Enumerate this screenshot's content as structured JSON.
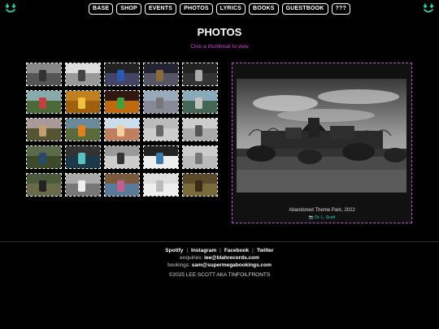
{
  "header": {
    "left_icon": "smiley-icon",
    "right_icon": "smiley-icon",
    "icon_color": "#2fd6b4"
  },
  "nav": [
    {
      "label": "BASE"
    },
    {
      "label": "SHOP"
    },
    {
      "label": "EVENTS"
    },
    {
      "label": "PHOTOS"
    },
    {
      "label": "LYRICS"
    },
    {
      "label": "BOOKS"
    },
    {
      "label": "GUESTBOOK"
    },
    {
      "label": "???"
    }
  ],
  "page": {
    "title": "PHOTOS",
    "subtitle": "Click a thumbnail to view",
    "accent": "#e040e0"
  },
  "thumbnails": [
    {
      "tone": [
        "#888",
        "#555",
        "#333"
      ]
    },
    {
      "tone": [
        "#ddd",
        "#999",
        "#444"
      ]
    },
    {
      "tone": [
        "#222",
        "#446",
        "#2a5ab0"
      ]
    },
    {
      "tone": [
        "#223",
        "#556",
        "#8a6a3a"
      ]
    },
    {
      "tone": [
        "#222",
        "#333",
        "#aaa"
      ]
    },
    {
      "tone": [
        "#8aa",
        "#4a6a3a",
        "#c04040"
      ]
    },
    {
      "tone": [
        "#c08020",
        "#a06010",
        "#f0c040"
      ]
    },
    {
      "tone": [
        "#301810",
        "#c06a10",
        "#40a040"
      ]
    },
    {
      "tone": [
        "#9ab",
        "#889",
        "#777"
      ]
    },
    {
      "tone": [
        "#8ab",
        "#465",
        "#c0c0c0"
      ]
    },
    {
      "tone": [
        "#a99",
        "#553",
        "#c0a070"
      ]
    },
    {
      "tone": [
        "#6a8a9a",
        "#5a6a3a",
        "#e08020"
      ]
    },
    {
      "tone": [
        "#cde",
        "#c08060",
        "#f0d0a0"
      ]
    },
    {
      "tone": [
        "#bbb",
        "#ccc",
        "#666"
      ]
    },
    {
      "tone": [
        "#ccc",
        "#aaa",
        "#555"
      ]
    },
    {
      "tone": [
        "#5a6a4a",
        "#3a4a2a",
        "#2a4a6a"
      ]
    },
    {
      "tone": [
        "#333",
        "#1a3a4a",
        "#5ac0c0"
      ]
    },
    {
      "tone": [
        "#999",
        "#ccc",
        "#333"
      ]
    },
    {
      "tone": [
        "#222",
        "#eee",
        "#3a7aaa"
      ]
    },
    {
      "tone": [
        "#ccc",
        "#bbb",
        "#777"
      ]
    },
    {
      "tone": [
        "#4a5a3a",
        "#6a6a4a",
        "#222"
      ]
    },
    {
      "tone": [
        "#aaa",
        "#777",
        "#eee"
      ]
    },
    {
      "tone": [
        "#7a5a3a",
        "#5a7a9a",
        "#c06090"
      ]
    },
    {
      "tone": [
        "#ddd",
        "#eee",
        "#bbb"
      ]
    },
    {
      "tone": [
        "#5a4a2a",
        "#7a6a3a",
        "#3a2a1a"
      ]
    }
  ],
  "viewer": {
    "caption": "Abandoned Theme Park, 2022",
    "credit": "📷 Dr. L. Scott",
    "border_color": "#c64fd8"
  },
  "footer": {
    "links": [
      "Spotify",
      "Instagram",
      "Facebook",
      "Twitter"
    ],
    "separator": "|",
    "enquiries_label": "enquiries:",
    "enquiries_email": "lee@blahrecords.com",
    "bookings_label": "bookings:",
    "bookings_email": "sam@supermegabookings.com",
    "copyright": "©2025 LEE SCOTT AKA TINFOILFRONTS"
  }
}
